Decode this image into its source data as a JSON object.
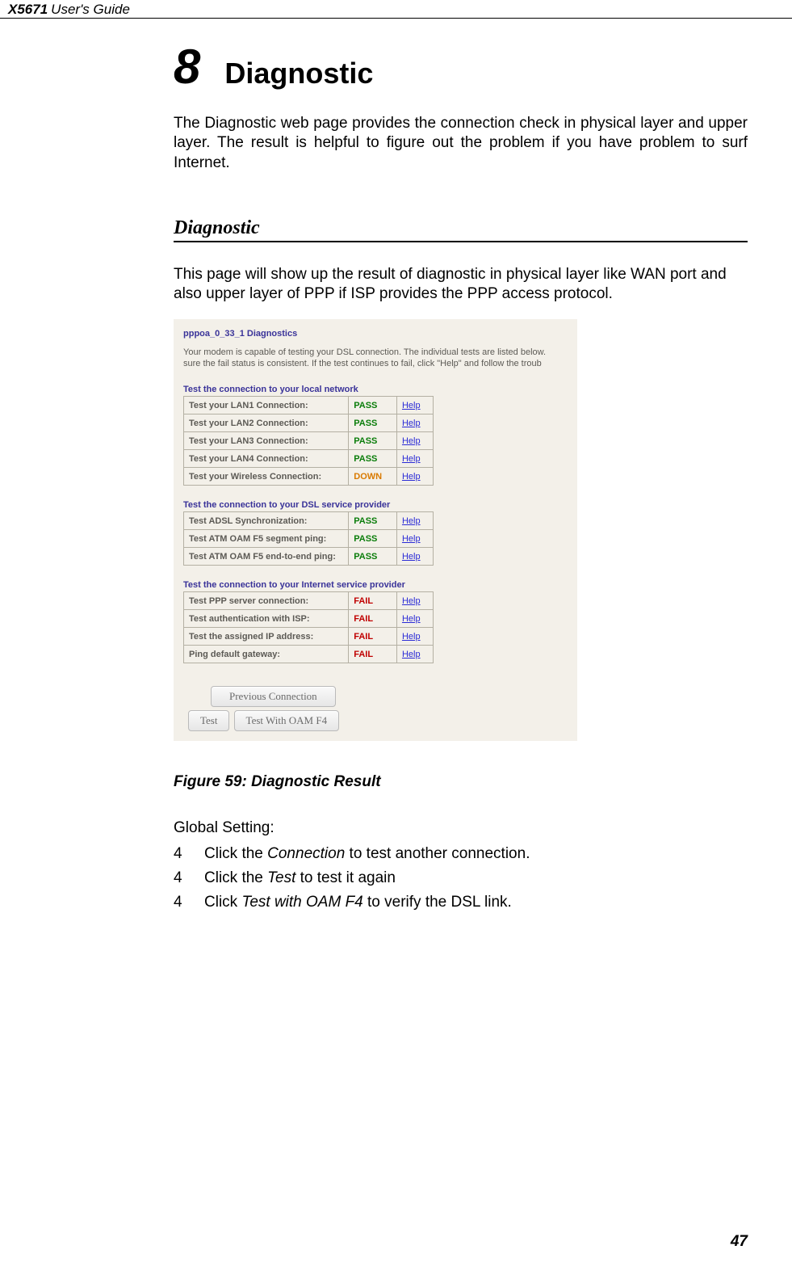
{
  "header": {
    "model": "X5671",
    "suffix": "User's Guide"
  },
  "chapter": {
    "number": "8",
    "title": "Diagnostic"
  },
  "intro": "The Diagnostic web page provides the connection check in physical layer and upper layer. The result is helpful to figure out the problem if you have problem to surf Internet.",
  "section_head": "Diagnostic",
  "section_intro": "This page will show up the result of diagnostic in physical layer like WAN port and also upper layer of PPP if ISP provides the PPP access protocol.",
  "shot": {
    "title": "pppoa_0_33_1 Diagnostics",
    "intro1": "Your modem is capable of testing your DSL connection. The individual tests are listed below.",
    "intro2": "sure the fail status is  consistent. If the test continues to fail, click \"Help\" and follow the troub",
    "group1": {
      "head": "Test the connection to your local network",
      "rows": [
        {
          "label": "Test your LAN1 Connection:",
          "result": "PASS",
          "cls": "pass"
        },
        {
          "label": "Test your LAN2 Connection:",
          "result": "PASS",
          "cls": "pass"
        },
        {
          "label": "Test your LAN3 Connection:",
          "result": "PASS",
          "cls": "pass"
        },
        {
          "label": "Test your LAN4 Connection:",
          "result": "PASS",
          "cls": "pass"
        },
        {
          "label": "Test your Wireless Connection:",
          "result": "DOWN",
          "cls": "down"
        }
      ]
    },
    "group2": {
      "head": "Test the connection to your DSL service provider",
      "rows": [
        {
          "label": "Test ADSL Synchronization:",
          "result": "PASS",
          "cls": "pass"
        },
        {
          "label": "Test ATM OAM F5 segment ping:",
          "result": "PASS",
          "cls": "pass"
        },
        {
          "label": "Test ATM OAM F5 end-to-end ping:",
          "result": "PASS",
          "cls": "pass"
        }
      ]
    },
    "group3": {
      "head": "Test the connection to your Internet service provider",
      "rows": [
        {
          "label": "Test PPP server connection:",
          "result": "FAIL",
          "cls": "fail"
        },
        {
          "label": "Test authentication with ISP:",
          "result": "FAIL",
          "cls": "fail"
        },
        {
          "label": "Test the assigned IP address:",
          "result": "FAIL",
          "cls": "fail"
        },
        {
          "label": "Ping default gateway:",
          "result": "FAIL",
          "cls": "fail"
        }
      ]
    },
    "help_label": "Help",
    "buttons": {
      "prev": "Previous Connection",
      "test": "Test",
      "test_oam": "Test With OAM F4"
    }
  },
  "figure_caption": "Figure 59: Diagnostic Result",
  "global_setting_head": "Global Setting:",
  "steps": [
    {
      "num": "4",
      "pre": "Click the ",
      "em": "Connection",
      "post": " to test another connection."
    },
    {
      "num": "4",
      "pre": "Click the ",
      "em": "Test",
      "post": " to test it again"
    },
    {
      "num": "4",
      "pre": "Click ",
      "em": "Test with OAM F4",
      "post": " to verify the DSL link."
    }
  ],
  "page_number": "47"
}
